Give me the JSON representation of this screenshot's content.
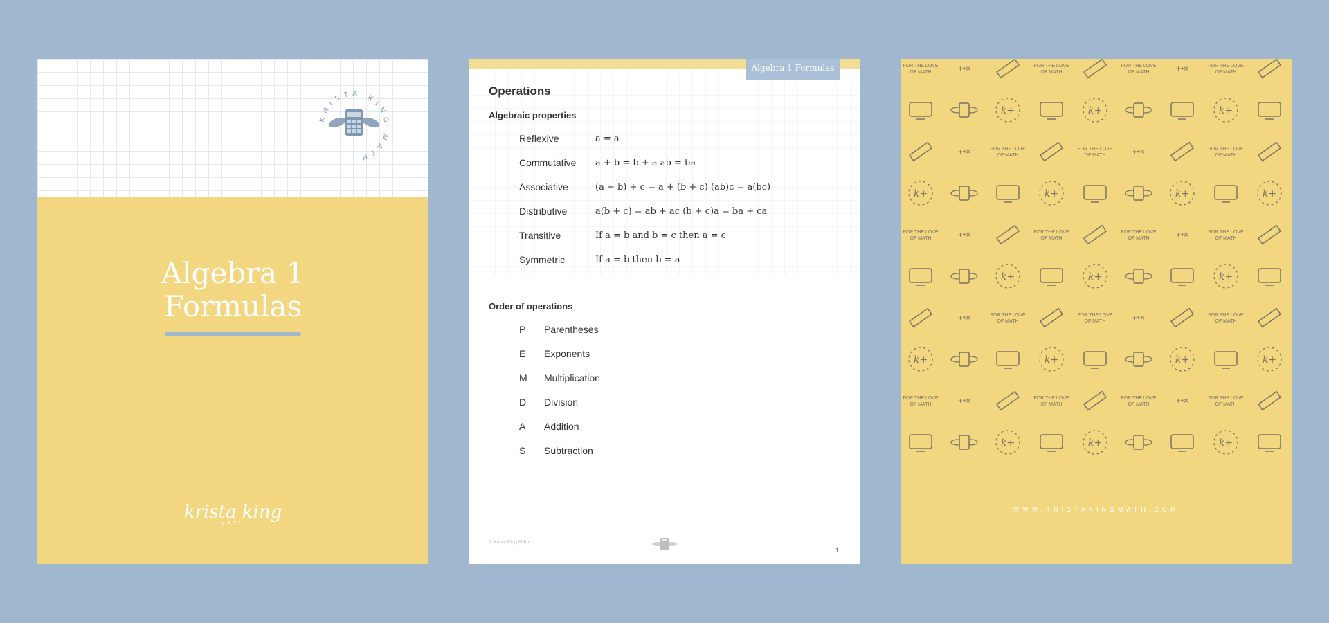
{
  "cover": {
    "seal_text": "KRISTA KING MATH",
    "title_line1": "Algebra 1",
    "title_line2": "Formulas",
    "logo_main": "krista king",
    "logo_sub": "MATH"
  },
  "content": {
    "tab_label": "Algebra 1 Formulas",
    "heading": "Operations",
    "algebraic_heading": "Algebraic properties",
    "properties": [
      {
        "name": "Reflexive",
        "formula": "a = a"
      },
      {
        "name": "Commutative",
        "formula": "a + b = b + a   ab = ba"
      },
      {
        "name": "Associative",
        "formula": "(a + b) + c = a + (b + c)     (ab)c = a(bc)"
      },
      {
        "name": "Distributive",
        "formula": "a(b + c) = ab + ac       (b + c)a = ba + ca"
      },
      {
        "name": "Transitive",
        "formula": "If a = b and b = c then a = c"
      },
      {
        "name": "Symmetric",
        "formula": "If a = b then b = a"
      }
    ],
    "order_heading": "Order of operations",
    "order": [
      {
        "letter": "P",
        "word": "Parentheses"
      },
      {
        "letter": "E",
        "word": "Exponents"
      },
      {
        "letter": "M",
        "word": "Multiplication"
      },
      {
        "letter": "D",
        "word": "Division"
      },
      {
        "letter": "A",
        "word": "Addition"
      },
      {
        "letter": "S",
        "word": "Subtraction"
      }
    ],
    "footer_copyright": "© Krista King Math",
    "page_number": "1"
  },
  "back": {
    "pattern_text_line1": "FOR THE LOVE",
    "pattern_text_line2": "OF MATH",
    "website": "WWW.KRISTAKINGMATH.COM"
  },
  "colors": {
    "background": "#a0b8cf",
    "yellow": "#f2d680",
    "accent_blue": "#a9c0d6",
    "icon_gray": "#7a7466"
  }
}
